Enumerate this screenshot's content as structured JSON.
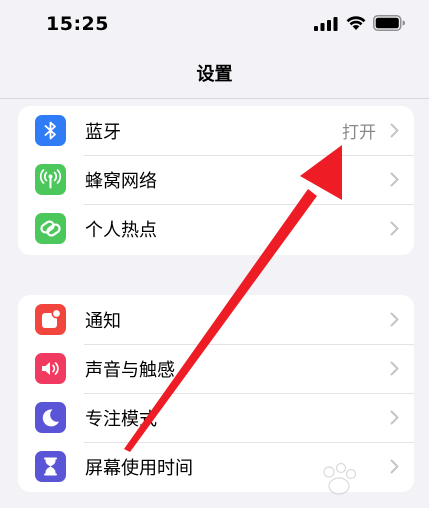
{
  "status_bar": {
    "time": "15:25"
  },
  "nav": {
    "title": "设置"
  },
  "groups": [
    {
      "items": [
        {
          "label": "蓝牙",
          "value": "打开",
          "icon": "bluetooth-icon",
          "color": "#2f7cf6"
        },
        {
          "label": "蜂窝网络",
          "value": "",
          "icon": "antenna-icon",
          "color": "#4cc75b"
        },
        {
          "label": "个人热点",
          "value": "",
          "icon": "hotspot-chain-icon",
          "color": "#4cc75b"
        }
      ]
    },
    {
      "items": [
        {
          "label": "通知",
          "icon": "notification-bell-icon",
          "color": "#f2453d"
        },
        {
          "label": "声音与触感",
          "icon": "speaker-icon",
          "color": "#f03a5f"
        },
        {
          "label": "专注模式",
          "icon": "moon-icon",
          "color": "#5a55d6"
        },
        {
          "label": "屏幕使用时间",
          "icon": "hourglass-icon",
          "color": "#5a55d6"
        }
      ]
    }
  ],
  "annotation": {
    "color": "#ee1c25"
  }
}
